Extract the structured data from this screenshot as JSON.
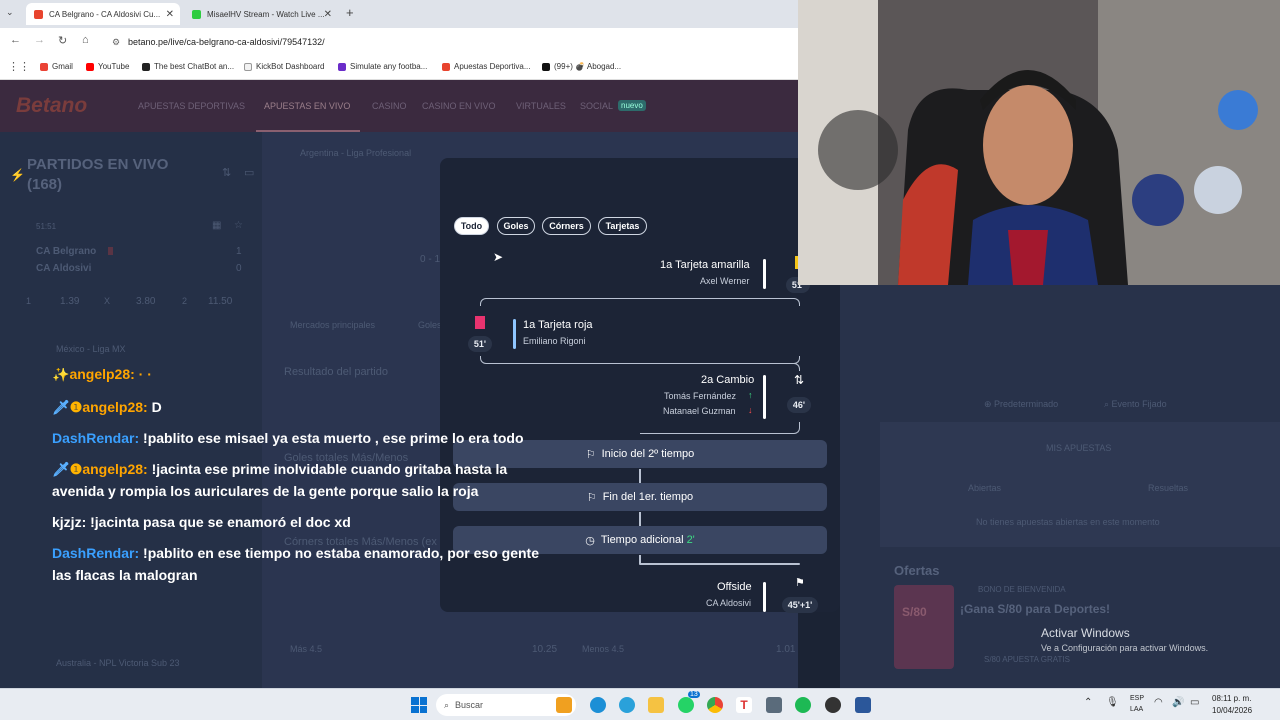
{
  "browser": {
    "tabs": [
      {
        "title": "CA Belgrano - CA Aldosivi Cu...",
        "active": true
      },
      {
        "title": "MisaelHV Stream - Watch Live ...",
        "active": false
      }
    ],
    "url": "betano.pe/live/ca-belgrano-ca-aldosivi/79547132/",
    "bookmarks": [
      "Gmail",
      "YouTube",
      "The best ChatBot an...",
      "KickBot Dashboard",
      "Simulate any footba...",
      "Apuestas Deportiva...",
      "(99+) 💣 Abogad..."
    ]
  },
  "site": {
    "logo": "Betano",
    "nav": [
      "APUESTAS DEPORTIVAS",
      "APUESTAS EN VIVO",
      "CASINO",
      "CASINO EN VIVO",
      "VIRTUALES",
      "SOCIAL"
    ],
    "nav_badge": "nuevo",
    "live_title": "PARTIDOS EN VIVO",
    "live_count": "(168)",
    "match_time": "51:51",
    "team1": "CA Belgrano",
    "team2": "CA Aldosivi",
    "score1": "1",
    "score2": "0",
    "odds": [
      "1",
      "1.39",
      "X",
      "3.80",
      "2",
      "11.50"
    ],
    "league_main": "Argentina - Liga Profesional",
    "league2": "México - Liga MX",
    "league3": "Australia - NPL Victoria Sub 23",
    "market_label": "Mercados principales",
    "market_tab2": "Goles",
    "result_label": "Resultado del partido",
    "goals_label": "Goles totales Más/Menos",
    "corners_label": "Córners totales Más/Menos (ex",
    "score_inline": "0 - 1",
    "mas": "Más 4.5",
    "mas_odd": "10.25",
    "menos": "Menos 4.5",
    "menos_odd": "1.01",
    "side_buttons": [
      "Predeterminado",
      "Evento Fijado"
    ],
    "mis_apuestas": "MIS APUESTAS",
    "bet_tabs": [
      "Abiertas",
      "Resueltas"
    ],
    "no_bets": "No tienes apuestas abiertas en este momento",
    "ofertas": "Ofertas",
    "bono_label": "BONO DE BIENVENIDA",
    "bono_title": "¡Gana S/80 para Deportes!",
    "bono_sub": "S/80 APUESTA GRATIS",
    "bono_img": "S/80"
  },
  "modal": {
    "filters": [
      "Todo",
      "Goles",
      "Córners",
      "Tarjetas"
    ],
    "events": {
      "e1_title": "1a Tarjeta amarilla",
      "e1_player": "Axel Werner",
      "e1_min": "51'",
      "e2_title": "1a Tarjeta roja",
      "e2_player": "Emiliano Rigoni",
      "e2_min": "51'",
      "e3_title": "2a Cambio",
      "e3_in": "Tomás Fernández",
      "e3_out": "Natanael Guzman",
      "e3_min": "46'",
      "p1": "Inicio del 2º tiempo",
      "p2": "Fin del 1er. tiempo",
      "p3_label": "Tiempo adicional",
      "p3_value": "2'",
      "e4_title": "Offside",
      "e4_team": "CA Aldosivi",
      "e4_min": "45'+1'"
    }
  },
  "chat": [
    {
      "user": "angelp28:",
      "msg": "D",
      "badges": true
    },
    {
      "user": "DashRendar:",
      "msg": "!pablito ese misael ya esta muerto , ese prime lo era todo"
    },
    {
      "user": "angelp28:",
      "msg": "!jacinta ese prime inolvidable cuando gritaba hasta la avenida y rompia los auriculares de la gente porque salio la roja",
      "badges": true
    },
    {
      "user": "kjzjz:",
      "msg": "!jacinta pasa que se enamoró el doc xd",
      "plain": true
    },
    {
      "user": "DashRendar:",
      "msg": "!pablito en ese tiempo no estaba enamorado, por eso gente las flacas la malogran"
    }
  ],
  "chat_partial": "angelp28: · ·",
  "activation": {
    "title": "Activar Windows",
    "sub": "Ve a Configuración para activar Windows."
  },
  "taskbar": {
    "search": "Buscar",
    "badge": "13",
    "lang1": "ESP",
    "lang2": "LAA",
    "time": "08:11 p. m.",
    "date": "10/04/2026"
  }
}
